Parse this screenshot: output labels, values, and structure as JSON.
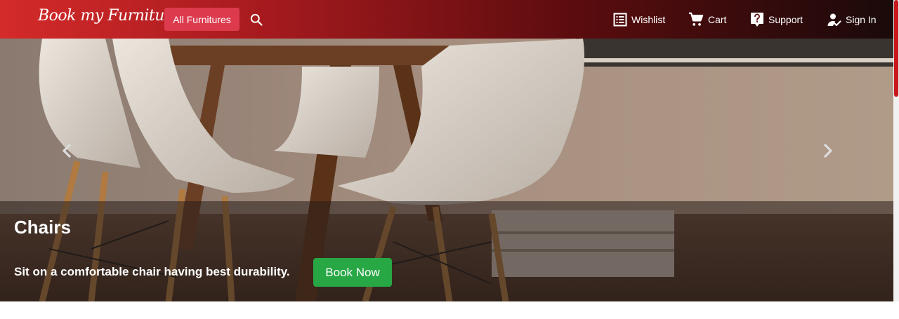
{
  "brand": {
    "name": "Book my Furniture"
  },
  "header": {
    "all_furnitures_label": "All Furnitures",
    "nav": {
      "wishlist": "Wishlist",
      "cart": "Cart",
      "support": "Support",
      "signin": "Sign In"
    }
  },
  "hero": {
    "title": "Chairs",
    "description": "Sit on a comfortable chair having best durability.",
    "cta_label": "Book Now"
  },
  "colors": {
    "navbar_start": "#d42a2a",
    "navbar_end": "#1a0a0a",
    "all_button": "#dd3a4e",
    "cta_button": "#28a745",
    "scroll_thumb": "#c8181e"
  },
  "icons": {
    "search": "search-icon",
    "wishlist": "list-icon",
    "cart": "cart-icon",
    "support": "help-icon",
    "signin": "user-check-icon",
    "prev": "chevron-left-icon",
    "next": "chevron-right-icon"
  }
}
